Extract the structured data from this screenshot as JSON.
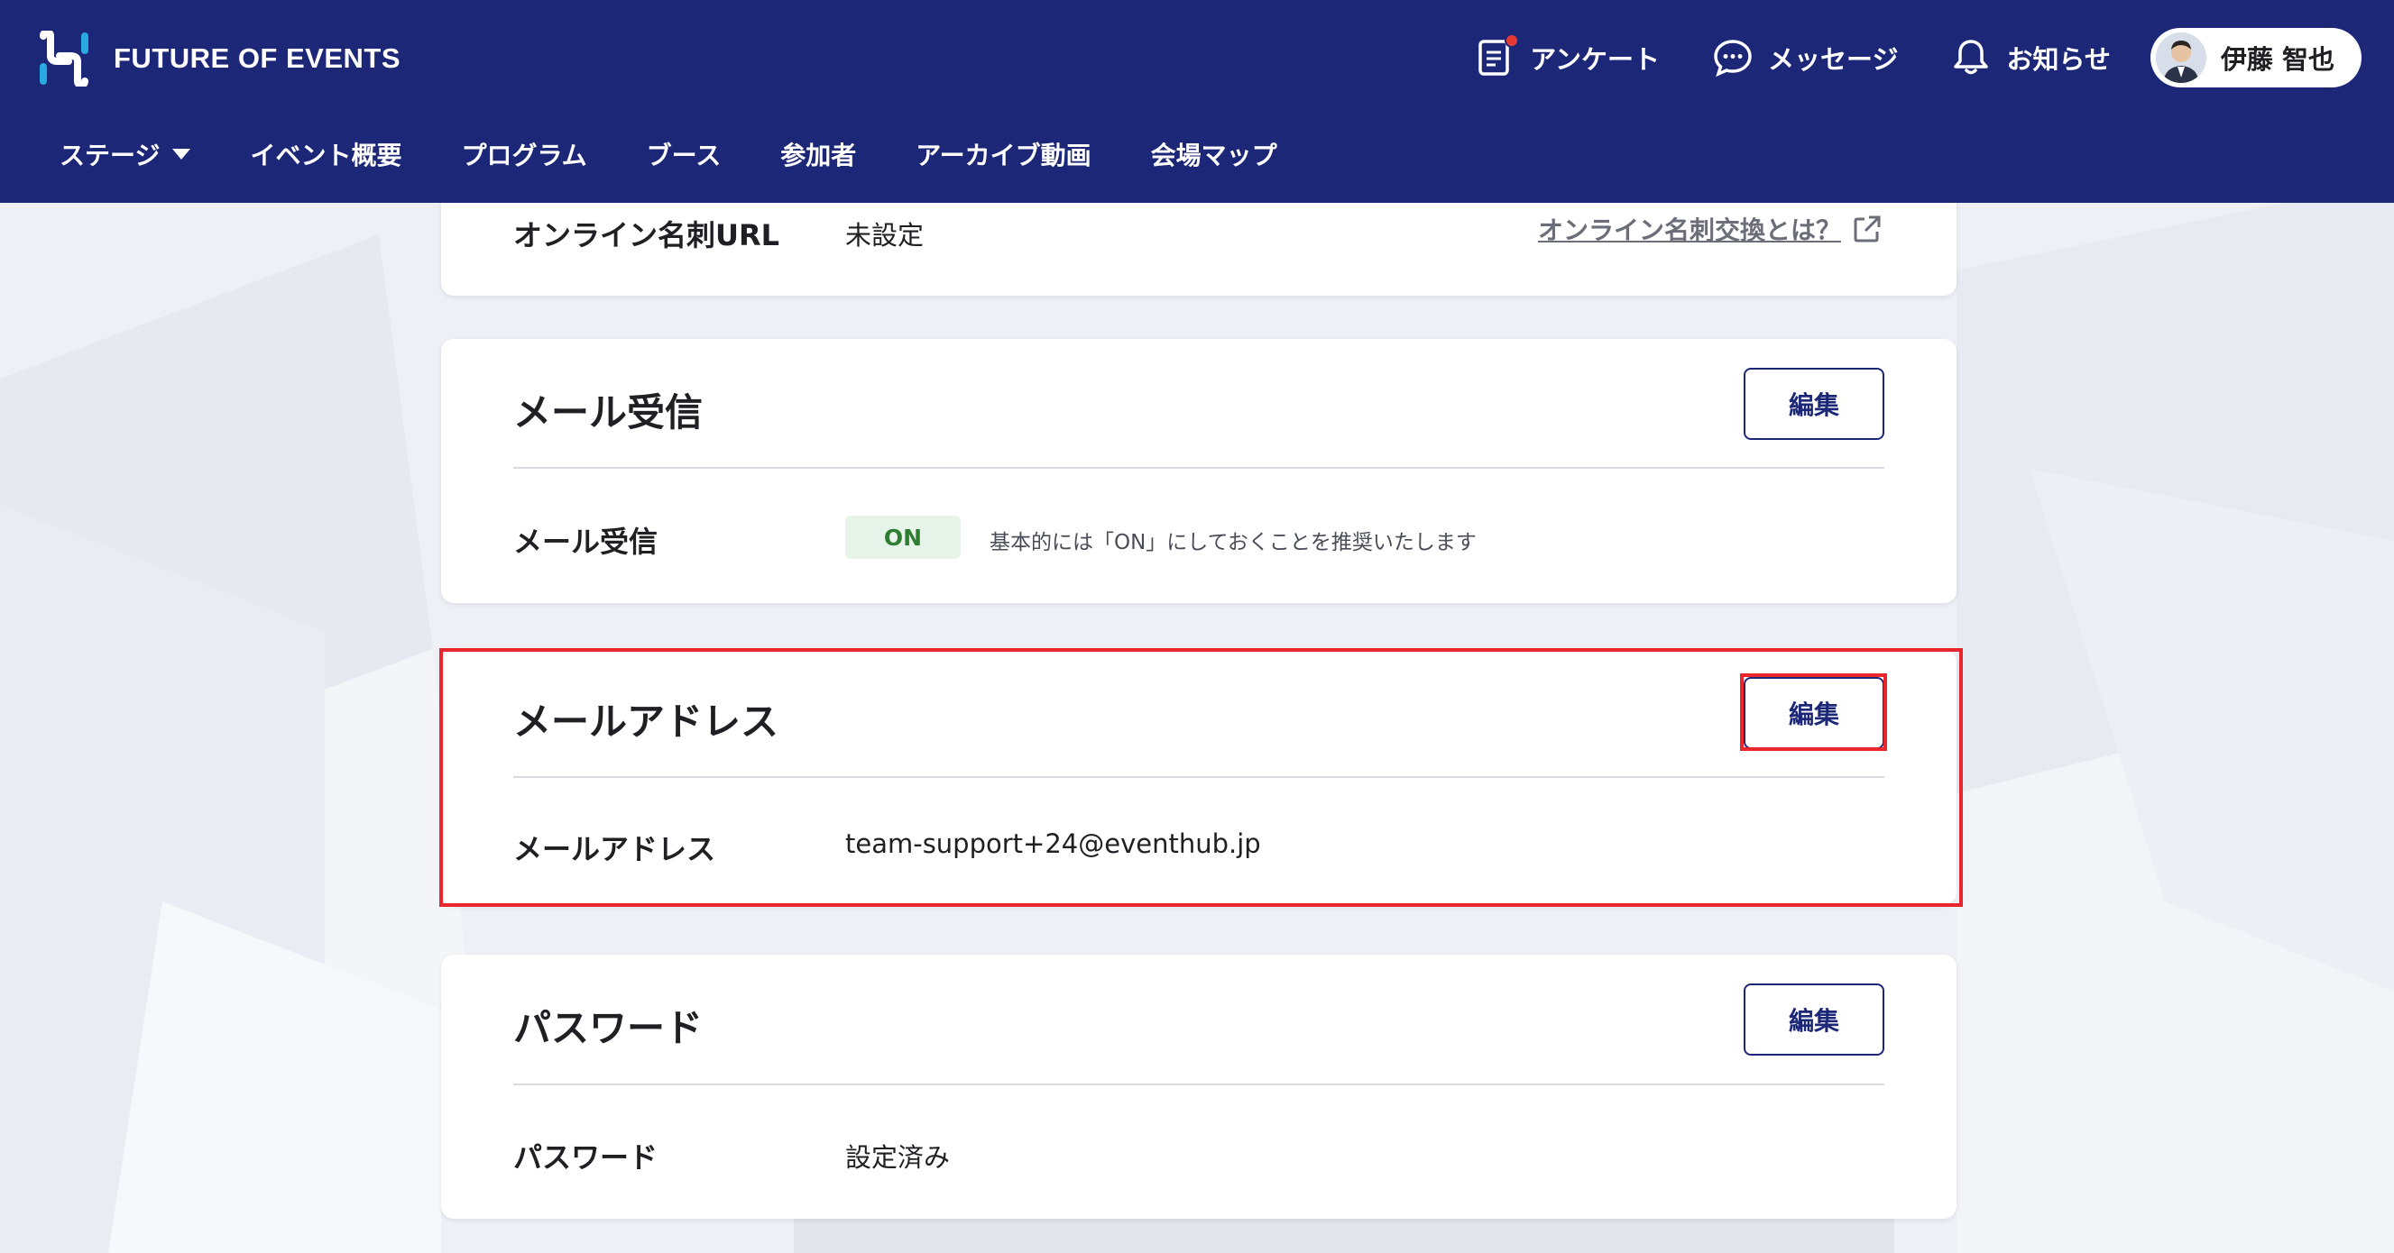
{
  "header": {
    "brand_name": "FUTURE OF EVENTS",
    "actions": [
      {
        "label": "アンケート",
        "icon": "survey-icon",
        "has_badge": true
      },
      {
        "label": "メッセージ",
        "icon": "message-icon"
      },
      {
        "label": "お知らせ",
        "icon": "bell-icon"
      }
    ],
    "user_name": "伊藤 智也"
  },
  "nav": {
    "items": [
      "ステージ",
      "イベント概要",
      "プログラム",
      "ブース",
      "参加者",
      "アーカイブ動画",
      "会場マップ"
    ]
  },
  "cards": {
    "online_card": {
      "label": "オンライン名刺URL",
      "value": "未設定",
      "link": "オンライン名刺交換とは？"
    },
    "mail_receive": {
      "title": "メール受信",
      "edit_label": "編集",
      "row_label": "メール受信",
      "status": "ON",
      "hint": "基本的には「ON」にしておくことを推奨いたします"
    },
    "email": {
      "title": "メールアドレス",
      "edit_label": "編集",
      "row_label": "メールアドレス",
      "value": "team-support+24@eventhub.jp"
    },
    "password": {
      "title": "パスワード",
      "edit_label": "編集",
      "row_label": "パスワード",
      "value": "設定済み"
    }
  },
  "colors": {
    "header_bg": "#1d2778",
    "highlight": "#e8262b",
    "on_badge_bg": "#e6f4ea",
    "on_badge_text": "#2e7d32"
  }
}
